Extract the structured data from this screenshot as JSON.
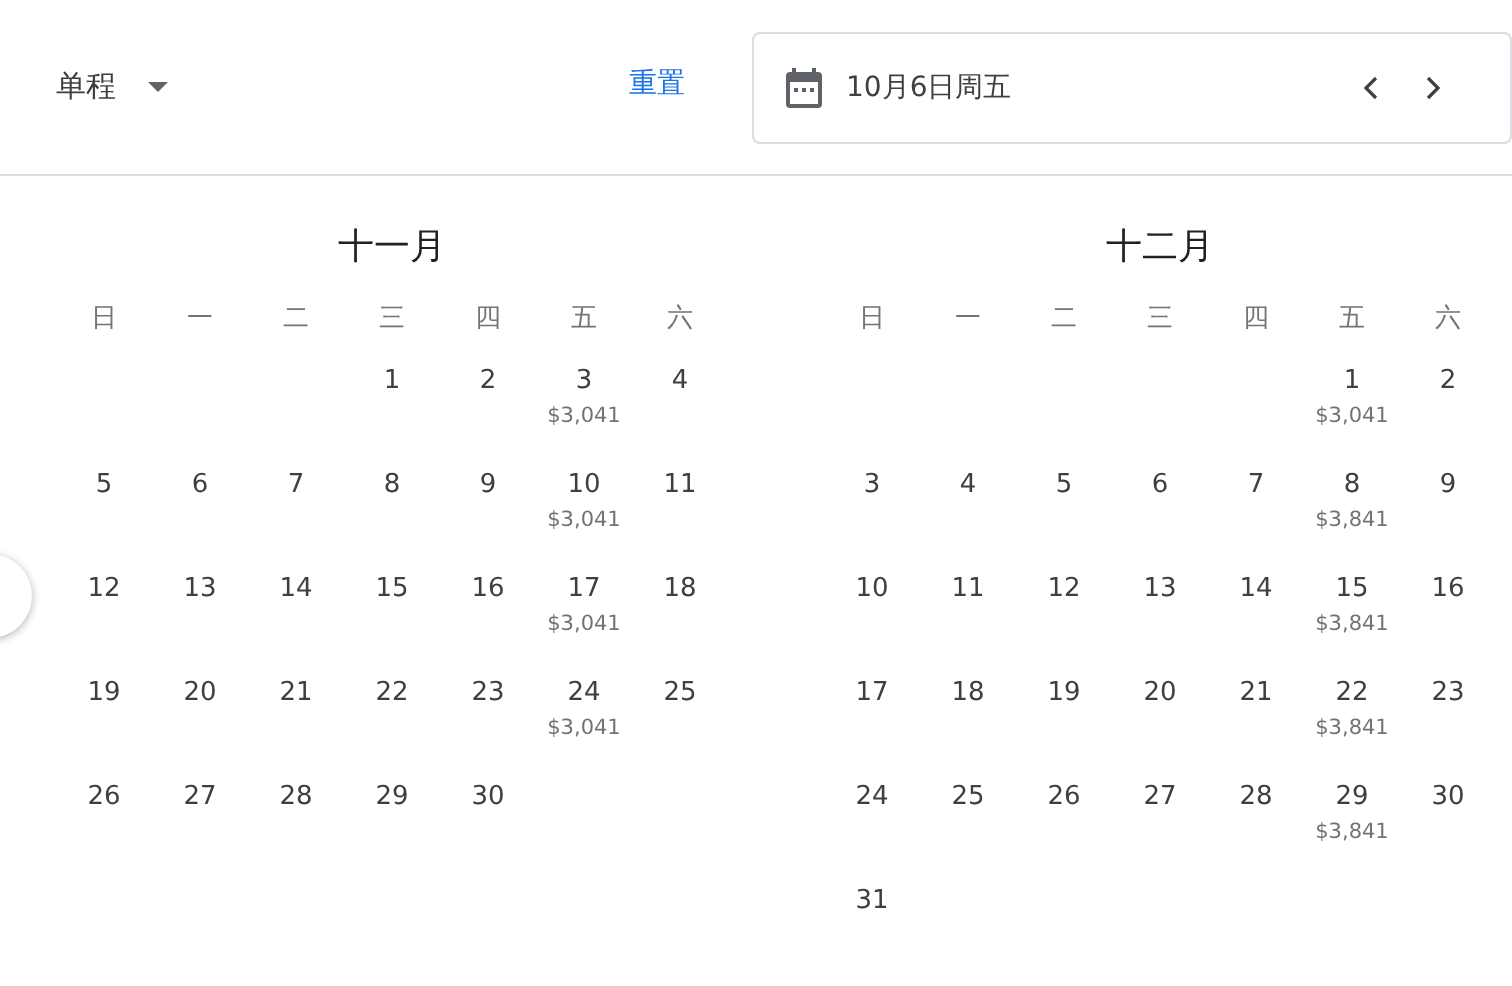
{
  "trip_type": {
    "label": "单程"
  },
  "reset_link": "重置",
  "date_field": {
    "value": "10月6日周五"
  },
  "months": [
    {
      "title": "十一月",
      "weekdays": [
        "日",
        "一",
        "二",
        "三",
        "四",
        "五",
        "六"
      ],
      "weeks": [
        [
          {
            "kind": "blank"
          },
          {
            "kind": "blank"
          },
          {
            "kind": "blank"
          },
          {
            "kind": "day",
            "day": "1"
          },
          {
            "kind": "day",
            "day": "2"
          },
          {
            "kind": "day",
            "day": "3",
            "price": "$3,041"
          },
          {
            "kind": "day",
            "day": "4"
          }
        ],
        [
          {
            "kind": "day",
            "day": "5"
          },
          {
            "kind": "day",
            "day": "6"
          },
          {
            "kind": "day",
            "day": "7"
          },
          {
            "kind": "day",
            "day": "8"
          },
          {
            "kind": "day",
            "day": "9"
          },
          {
            "kind": "day",
            "day": "10",
            "price": "$3,041"
          },
          {
            "kind": "day",
            "day": "11"
          }
        ],
        [
          {
            "kind": "day",
            "day": "12"
          },
          {
            "kind": "day",
            "day": "13"
          },
          {
            "kind": "day",
            "day": "14"
          },
          {
            "kind": "day",
            "day": "15"
          },
          {
            "kind": "day",
            "day": "16"
          },
          {
            "kind": "day",
            "day": "17",
            "price": "$3,041"
          },
          {
            "kind": "day",
            "day": "18"
          }
        ],
        [
          {
            "kind": "day",
            "day": "19"
          },
          {
            "kind": "day",
            "day": "20"
          },
          {
            "kind": "day",
            "day": "21"
          },
          {
            "kind": "day",
            "day": "22"
          },
          {
            "kind": "day",
            "day": "23"
          },
          {
            "kind": "day",
            "day": "24",
            "price": "$3,041"
          },
          {
            "kind": "day",
            "day": "25"
          }
        ],
        [
          {
            "kind": "day",
            "day": "26"
          },
          {
            "kind": "day",
            "day": "27"
          },
          {
            "kind": "day",
            "day": "28"
          },
          {
            "kind": "day",
            "day": "29"
          },
          {
            "kind": "day",
            "day": "30"
          }
        ]
      ]
    },
    {
      "title": "十二月",
      "weekdays": [
        "日",
        "一",
        "二",
        "三",
        "四",
        "五",
        "六"
      ],
      "weeks": [
        [
          {
            "kind": "blank"
          },
          {
            "kind": "blank"
          },
          {
            "kind": "blank"
          },
          {
            "kind": "blank"
          },
          {
            "kind": "blank"
          },
          {
            "kind": "day",
            "day": "1",
            "price": "$3,041"
          },
          {
            "kind": "day",
            "day": "2"
          }
        ],
        [
          {
            "kind": "day",
            "day": "3"
          },
          {
            "kind": "day",
            "day": "4"
          },
          {
            "kind": "day",
            "day": "5"
          },
          {
            "kind": "day",
            "day": "6"
          },
          {
            "kind": "day",
            "day": "7"
          },
          {
            "kind": "day",
            "day": "8",
            "price": "$3,841"
          },
          {
            "kind": "day",
            "day": "9"
          }
        ],
        [
          {
            "kind": "day",
            "day": "10"
          },
          {
            "kind": "day",
            "day": "11"
          },
          {
            "kind": "day",
            "day": "12"
          },
          {
            "kind": "day",
            "day": "13"
          },
          {
            "kind": "day",
            "day": "14"
          },
          {
            "kind": "day",
            "day": "15",
            "price": "$3,841"
          },
          {
            "kind": "day",
            "day": "16"
          }
        ],
        [
          {
            "kind": "day",
            "day": "17"
          },
          {
            "kind": "day",
            "day": "18"
          },
          {
            "kind": "day",
            "day": "19"
          },
          {
            "kind": "day",
            "day": "20"
          },
          {
            "kind": "day",
            "day": "21"
          },
          {
            "kind": "day",
            "day": "22",
            "price": "$3,841"
          },
          {
            "kind": "day",
            "day": "23"
          }
        ],
        [
          {
            "kind": "day",
            "day": "24"
          },
          {
            "kind": "day",
            "day": "25"
          },
          {
            "kind": "day",
            "day": "26"
          },
          {
            "kind": "day",
            "day": "27"
          },
          {
            "kind": "day",
            "day": "28"
          },
          {
            "kind": "day",
            "day": "29",
            "price": "$3,841"
          },
          {
            "kind": "day",
            "day": "30"
          }
        ],
        [
          {
            "kind": "day",
            "day": "31"
          }
        ]
      ]
    }
  ]
}
